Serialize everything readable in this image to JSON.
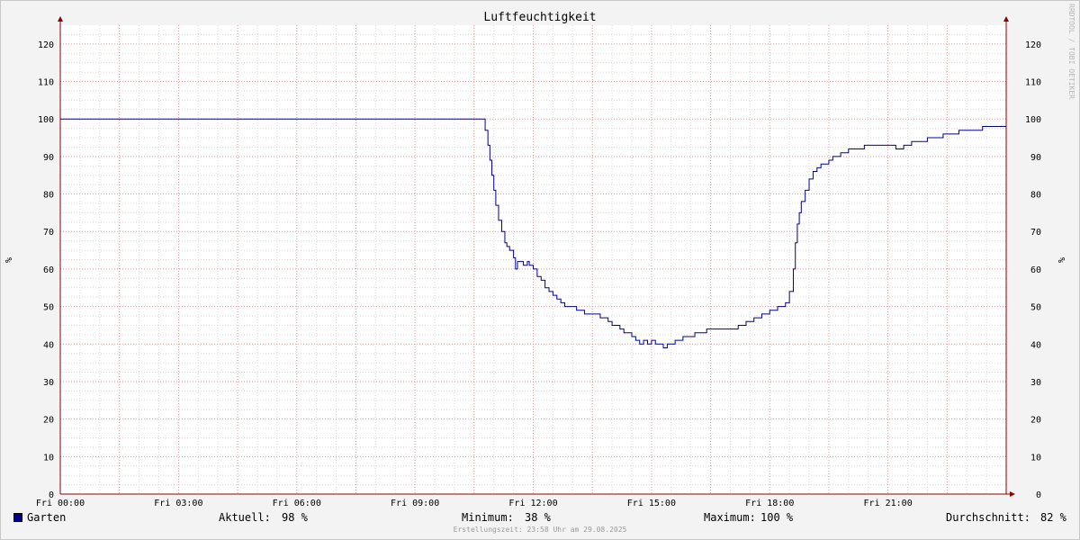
{
  "colors": {
    "background": "#f3f3f3",
    "plot_background": "#ffffff",
    "minor_grid": "#dcdcdc",
    "major_grid": "#e59a9a",
    "axis": "#8b0000",
    "series": "#00008b"
  },
  "watermark": "RRDTOOL / TOBI OETIKER",
  "legend": {
    "series_name": "Garten",
    "current_label": "Aktuell:",
    "current_value": "98 %",
    "min_label": "Minimum:",
    "min_value": "38 %",
    "max_label": "Maximum:",
    "max_value": "100 %",
    "avg_label": "Durchschnitt:",
    "avg_value": "82 %"
  },
  "footer": "Erstellungszeit: 23:58 Uhr am 29.08.2025",
  "chart_data": {
    "type": "line",
    "title": "Luftfeuchtigkeit",
    "ylabel": "%",
    "ylabel_right": "%",
    "xlim": [
      0,
      24
    ],
    "ylim": [
      0,
      125
    ],
    "y_ticks": [
      0,
      10,
      20,
      30,
      40,
      50,
      60,
      70,
      80,
      90,
      100,
      110,
      120
    ],
    "x_tick_hours": [
      0,
      3,
      6,
      9,
      12,
      15,
      18,
      21
    ],
    "x_tick_labels": [
      "Fri 00:00",
      "Fri 03:00",
      "Fri 06:00",
      "Fri 09:00",
      "Fri 12:00",
      "Fri 15:00",
      "Fri 18:00",
      "Fri 21:00"
    ],
    "grid": true,
    "legend_position": "bottom",
    "series": [
      {
        "name": "Garten",
        "color": "#00008b",
        "x": [
          0,
          10.72,
          10.78,
          10.85,
          10.9,
          10.95,
          11.0,
          11.05,
          11.12,
          11.2,
          11.28,
          11.33,
          11.4,
          11.5,
          11.55,
          11.6,
          11.65,
          11.7,
          11.75,
          11.8,
          11.85,
          11.9,
          12.0,
          12.1,
          12.2,
          12.3,
          12.4,
          12.5,
          12.6,
          12.7,
          12.8,
          12.9,
          13.0,
          13.1,
          13.2,
          13.3,
          13.4,
          13.5,
          13.6,
          13.7,
          13.8,
          13.9,
          14.0,
          14.1,
          14.2,
          14.3,
          14.4,
          14.5,
          14.6,
          14.7,
          14.8,
          14.9,
          15.0,
          15.1,
          15.2,
          15.3,
          15.4,
          15.5,
          15.6,
          15.7,
          15.8,
          15.9,
          16.0,
          16.1,
          16.2,
          16.3,
          16.4,
          16.6,
          16.8,
          17.0,
          17.2,
          17.4,
          17.6,
          17.8,
          18.0,
          18.2,
          18.4,
          18.5,
          18.6,
          18.65,
          18.7,
          18.75,
          18.8,
          18.9,
          19.0,
          19.1,
          19.2,
          19.3,
          19.4,
          19.5,
          19.6,
          19.7,
          19.8,
          20.0,
          20.2,
          20.4,
          20.6,
          20.8,
          21.0,
          21.2,
          21.4,
          21.6,
          21.8,
          22.0,
          22.2,
          22.4,
          22.6,
          22.8,
          23.0,
          23.2,
          23.4,
          23.6,
          23.8,
          24.0
        ],
        "values": [
          100,
          100,
          97,
          93,
          89,
          85,
          81,
          77,
          73,
          70,
          67,
          66,
          65,
          63,
          60,
          62,
          62,
          62,
          61,
          61,
          62,
          61,
          60,
          58,
          57,
          55,
          54,
          53,
          52,
          51,
          50,
          50,
          50,
          49,
          49,
          48,
          48,
          48,
          48,
          47,
          47,
          46,
          45,
          45,
          44,
          43,
          43,
          42,
          41,
          40,
          41,
          40,
          41,
          40,
          40,
          39,
          40,
          40,
          41,
          41,
          42,
          42,
          42,
          43,
          43,
          43,
          44,
          44,
          44,
          44,
          45,
          46,
          47,
          48,
          49,
          50,
          51,
          54,
          60,
          67,
          72,
          75,
          78,
          81,
          84,
          86,
          87,
          88,
          88,
          89,
          90,
          90,
          91,
          92,
          92,
          93,
          93,
          93,
          93,
          92,
          93,
          94,
          94,
          95,
          95,
          96,
          96,
          97,
          97,
          97,
          98,
          98,
          98,
          98
        ]
      }
    ]
  }
}
